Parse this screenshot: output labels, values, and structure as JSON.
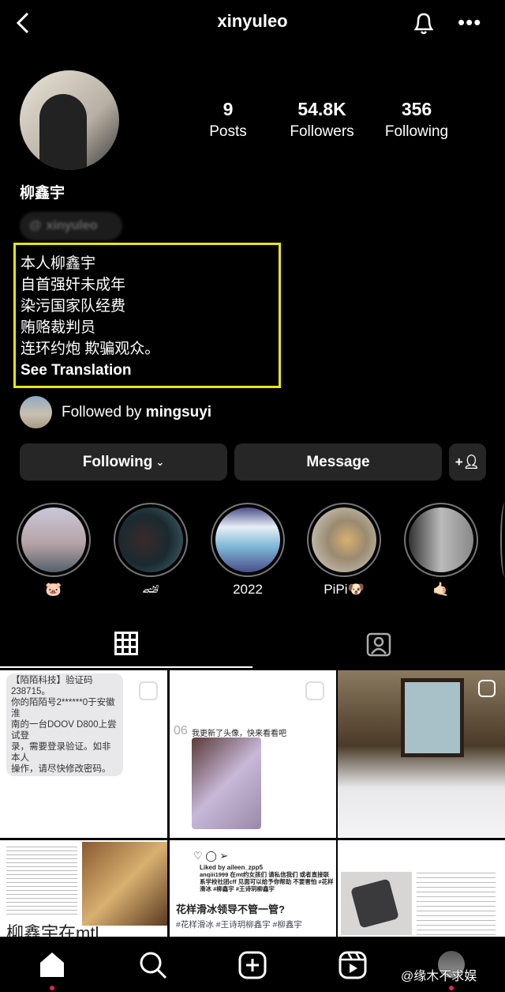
{
  "header": {
    "username": "xinyuleo"
  },
  "profile": {
    "display_name": "柳鑫宇",
    "threads_handle": "xinyuleo",
    "stats": [
      {
        "value": "9",
        "label": "Posts"
      },
      {
        "value": "54.8K",
        "label": "Followers"
      },
      {
        "value": "356",
        "label": "Following"
      }
    ],
    "bio_lines": [
      "本人柳鑫宇",
      "自首强奸未成年",
      "染污国家队经费",
      "贿赂裁判员",
      "连环约炮 欺骗观众。"
    ],
    "see_translation": "See Translation",
    "followed_by_prefix": "Followed by ",
    "followed_by_user": "mingsuyi"
  },
  "actions": {
    "following": "Following",
    "message": "Message"
  },
  "highlights": [
    {
      "label": "🐷"
    },
    {
      "label": "🏎"
    },
    {
      "label": "2022"
    },
    {
      "label": "PiPi🐶"
    },
    {
      "label": "🤙🏻"
    }
  ],
  "posts": {
    "p1": {
      "lines": [
        "【陌陌科技】验证码238715。",
        "你的陌陌号2******0于安徽淮",
        "南的一台DOOV D800上尝试登",
        "录，需要登录验证。如非本人",
        "操作，请尽快修改密码。"
      ]
    },
    "p2": {
      "day": "06",
      "text": "我更新了头像，快来看看吧"
    },
    "p4": {
      "title": "柳鑫宇在mtl"
    },
    "p5": {
      "liked": "Liked by aileen_zpp5",
      "caption": "anqiii1999 在mt约女孩们 请私信我们 或者直接联系学校社团cff 见面可以给予你帮助 不要害怕 #花样滑冰 #柳鑫宇 #王诗玥柳鑫宇",
      "title": "花样滑冰领导不管一管?",
      "tags": "#花样滑冰  #王诗玥柳鑫宇  #柳鑫宇"
    }
  },
  "watermark": "@缘木不求娱",
  "colors": {
    "highlight_box": "#e6e61a",
    "button_bg": "#262626",
    "notification_dot": "#e0245e"
  }
}
